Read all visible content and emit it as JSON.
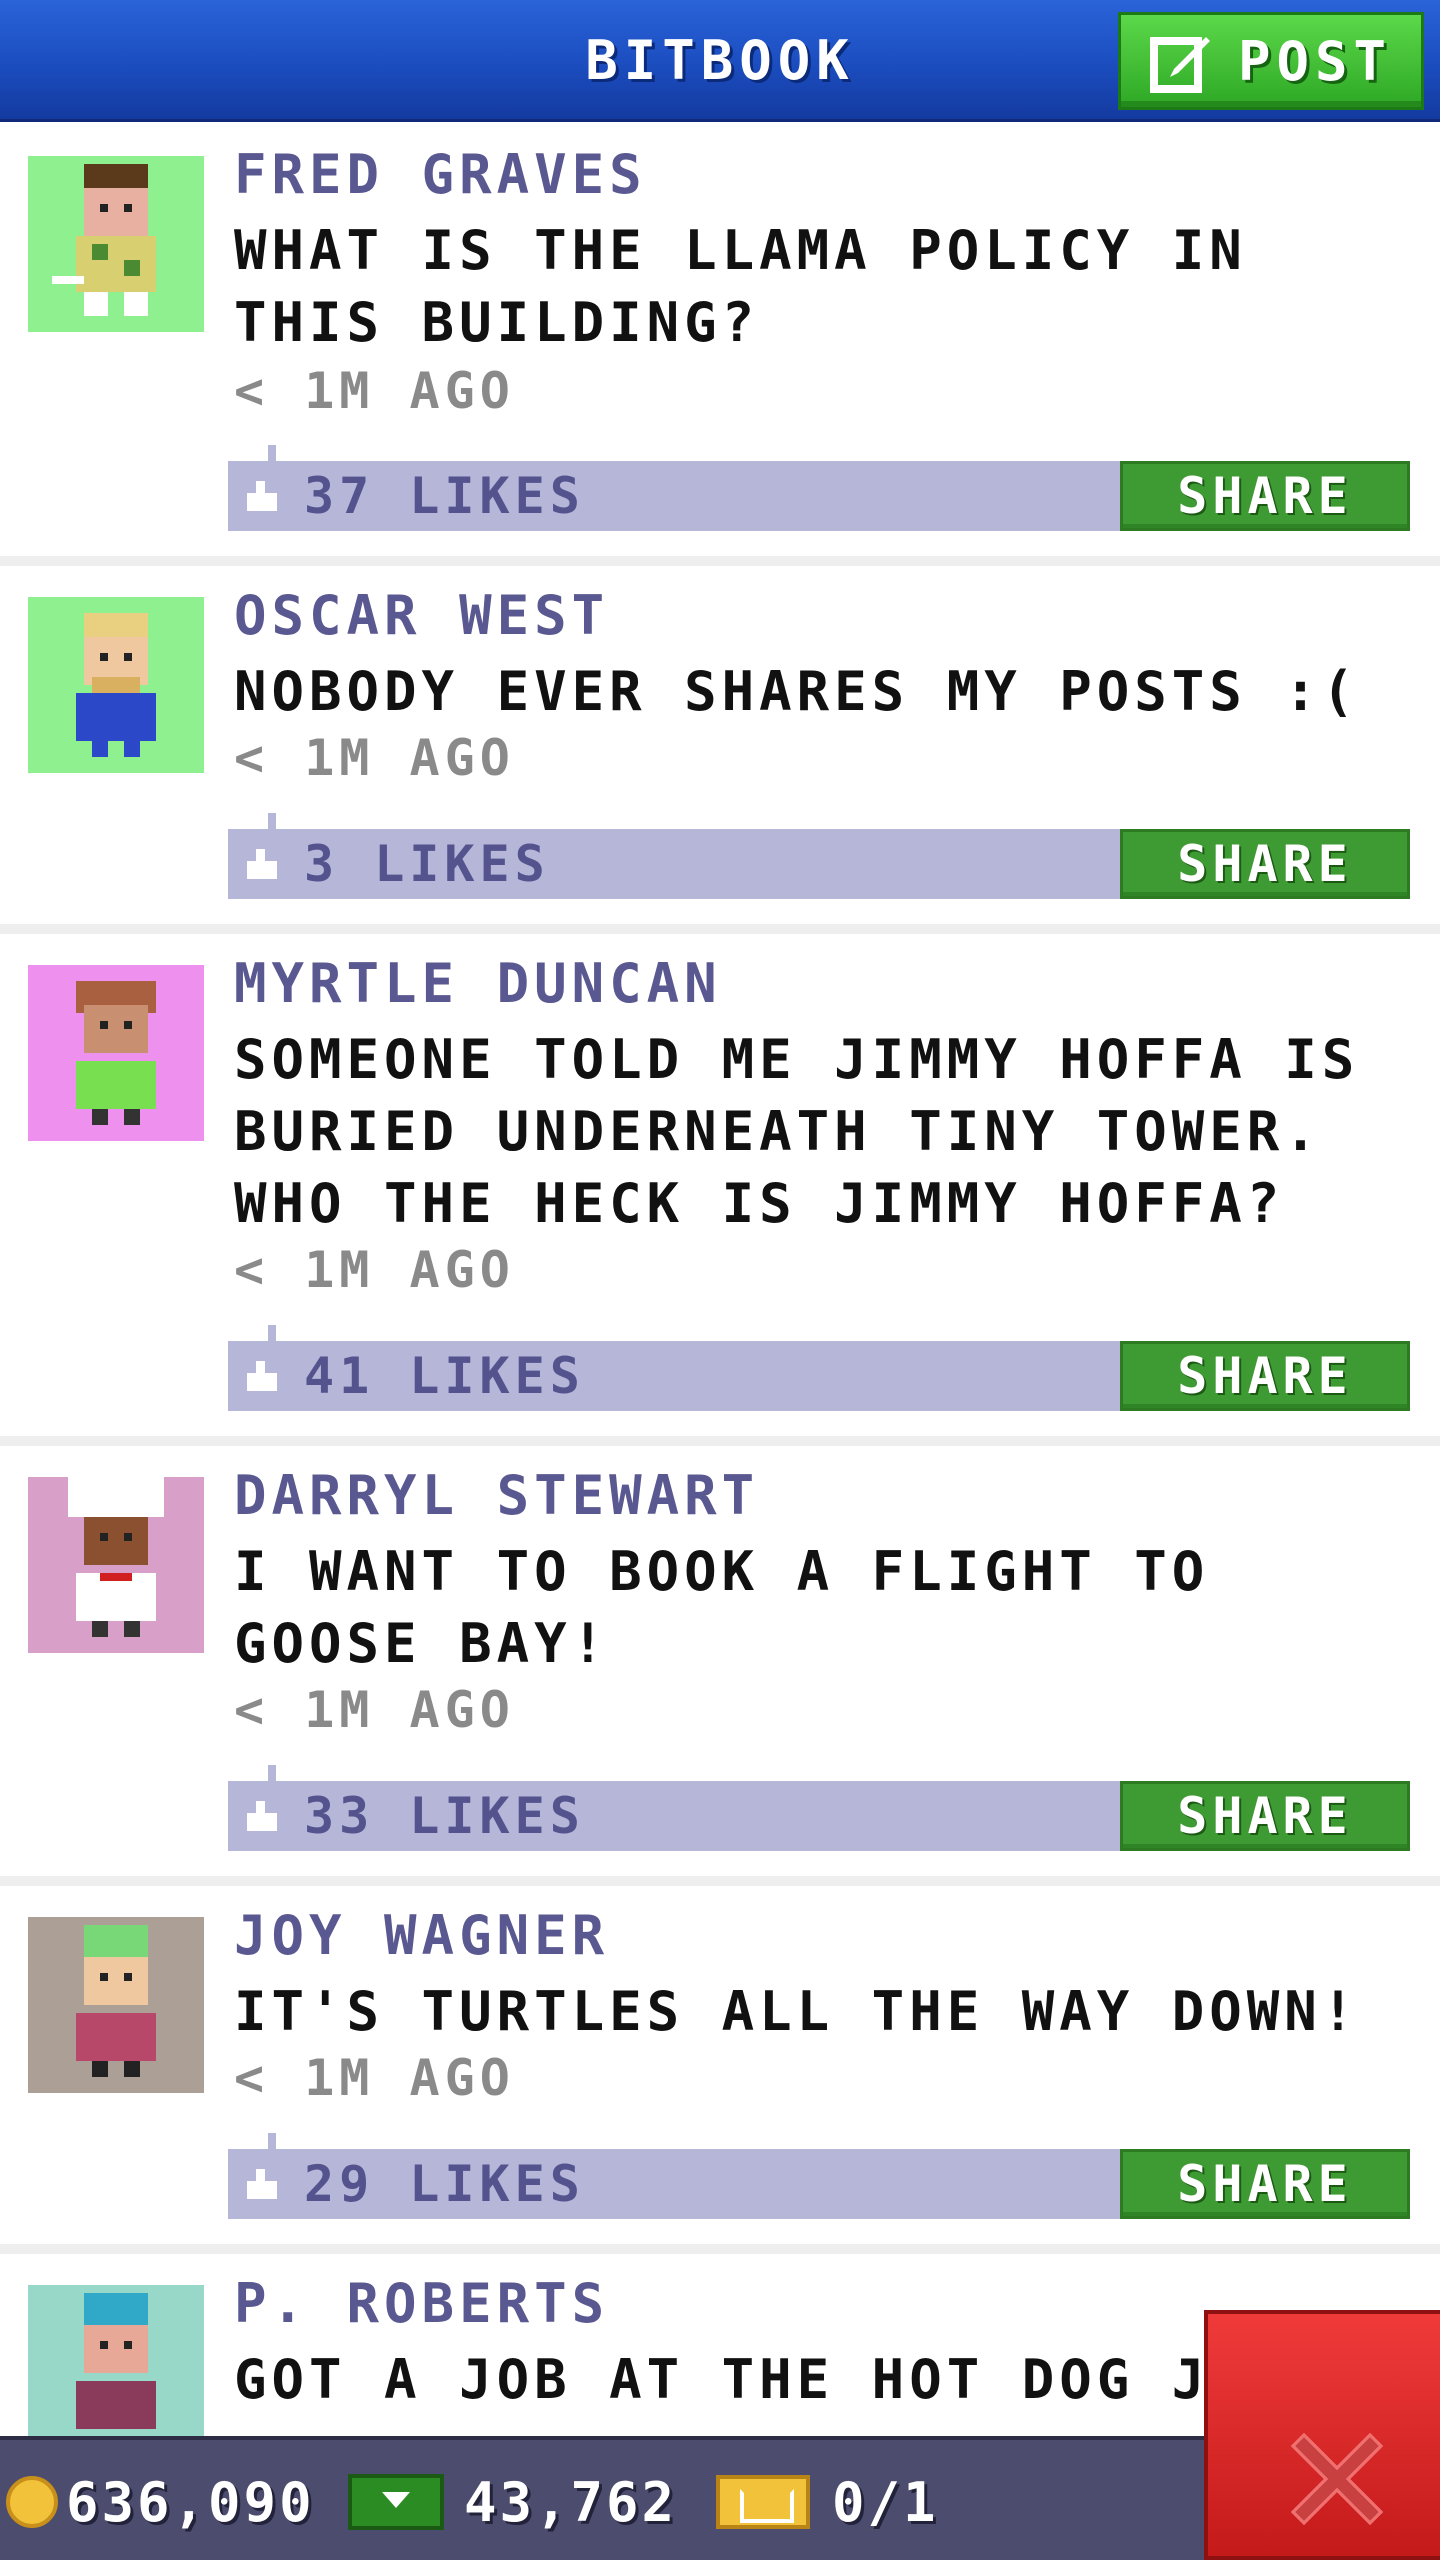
{
  "header": {
    "title": "BITBOOK",
    "post_label": "POST"
  },
  "posts": [
    {
      "name": "FRED GRAVES",
      "message": "WHAT IS THE LLAMA POLICY IN THIS BUILDING?",
      "time": "< 1M AGO",
      "likes": "37 LIKES",
      "share_label": "SHARE",
      "avatar_bg": "#8ef08e"
    },
    {
      "name": "OSCAR WEST",
      "message": "NOBODY EVER SHARES MY POSTS :(",
      "time": "< 1M AGO",
      "likes": "3 LIKES",
      "share_label": "SHARE",
      "avatar_bg": "#8ef08e"
    },
    {
      "name": "MYRTLE DUNCAN",
      "message": "SOMEONE TOLD ME JIMMY HOFFA IS BURIED UNDERNEATH TINY TOWER. WHO THE HECK IS JIMMY HOFFA?",
      "time": "< 1M AGO",
      "likes": "41 LIKES",
      "share_label": "SHARE",
      "avatar_bg": "#ee90ee"
    },
    {
      "name": "DARRYL STEWART",
      "message": "I WANT TO BOOK A FLIGHT TO GOOSE BAY!",
      "time": "< 1M AGO",
      "likes": "33 LIKES",
      "share_label": "SHARE",
      "avatar_bg": "#d8a0c8"
    },
    {
      "name": "JOY WAGNER",
      "message": "IT'S TURTLES ALL THE WAY DOWN!",
      "time": "< 1M AGO",
      "likes": "29 LIKES",
      "share_label": "SHARE",
      "avatar_bg": "#aca096"
    },
    {
      "name": "P. ROBERTS",
      "message": "GOT A JOB AT THE HOT DOG JOINT",
      "avatar_bg": "#98d8c8"
    }
  ],
  "currency": {
    "coins": "636,090",
    "bux": "43,762",
    "tickets": "0/1"
  },
  "colors": {
    "header_blue": "#1c4fc2",
    "share_green": "#3e9a32",
    "likebar": "#b5b6d8",
    "name_purple": "#5a5890",
    "close_red": "#d42020"
  }
}
